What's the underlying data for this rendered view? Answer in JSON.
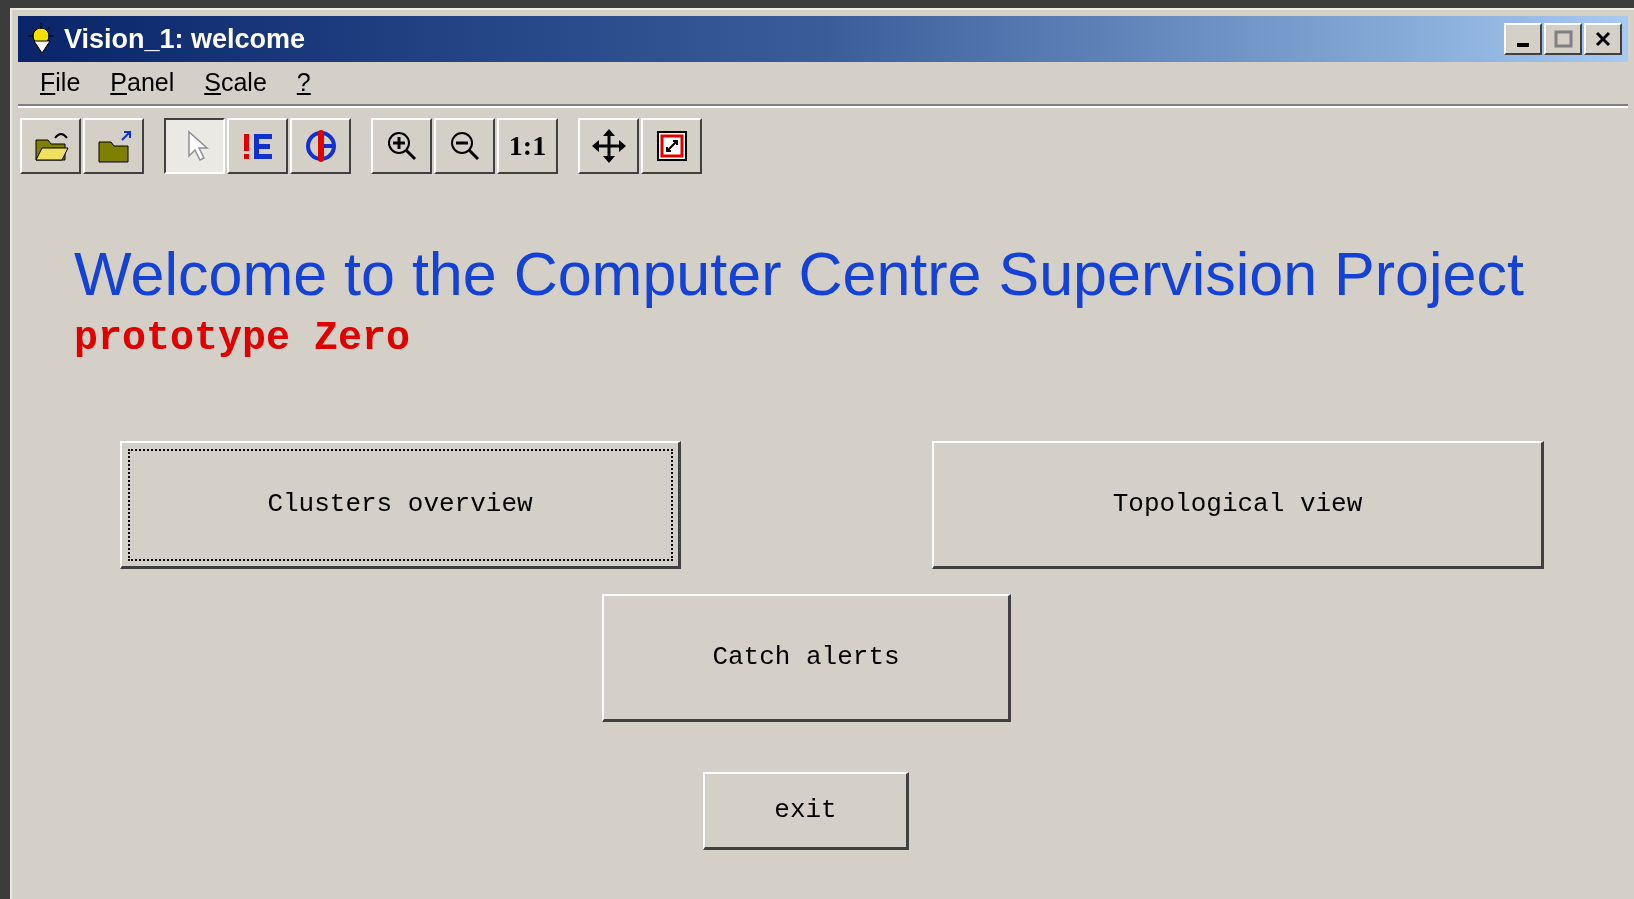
{
  "window": {
    "title": "Vision_1: welcome",
    "controls": [
      {
        "kind": "minimize",
        "disabled": false
      },
      {
        "kind": "maximize",
        "disabled": true
      },
      {
        "kind": "close",
        "disabled": false
      }
    ]
  },
  "menu": [
    {
      "label": "File",
      "first_underlined": true
    },
    {
      "label": "Panel",
      "first_underlined": true
    },
    {
      "label": "Scale",
      "first_underlined": true
    },
    {
      "label": "?",
      "first_underlined": true
    }
  ],
  "toolbar": [
    [
      {
        "kind": "open",
        "selected": false
      },
      {
        "kind": "open-parent",
        "selected": false
      }
    ],
    [
      {
        "kind": "pointer",
        "selected": true
      },
      {
        "kind": "edit",
        "selected": false
      },
      {
        "kind": "graphic",
        "selected": false
      }
    ],
    [
      {
        "kind": "zoom-in",
        "selected": false
      },
      {
        "kind": "zoom-out",
        "selected": false
      },
      {
        "kind": "text",
        "label": "1:1",
        "selected": false
      }
    ],
    [
      {
        "kind": "pan",
        "selected": false
      },
      {
        "kind": "fit",
        "selected": false
      }
    ]
  ],
  "heading": "Welcome to the Computer Centre Supervision Project",
  "subtitle": "prototype Zero",
  "buttons": [
    {
      "label": "Clusters overview",
      "focused": true
    },
    {
      "label": "Topological view",
      "focused": false
    },
    {
      "label": "Catch alerts",
      "focused": false
    },
    {
      "label": "exit",
      "focused": false
    }
  ]
}
